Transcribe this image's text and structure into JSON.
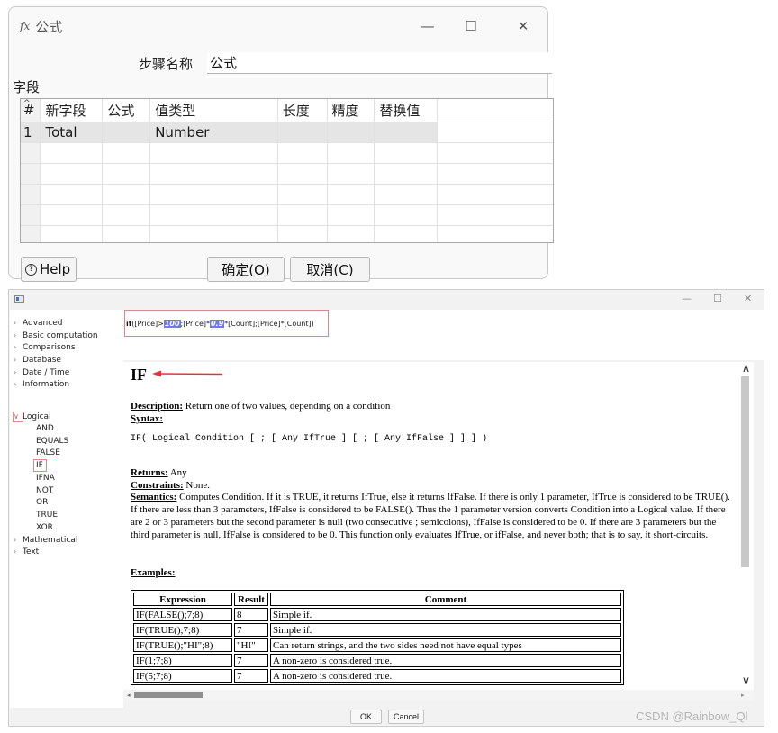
{
  "dialog": {
    "title": "公式",
    "fx_icon": "fx",
    "minimize": "—",
    "maximize": "☐",
    "close": "✕",
    "step_name_label": "步骤名称",
    "step_name_value": "公式",
    "fields_label": "字段",
    "table": {
      "sort_marker": "^",
      "headers": [
        "#",
        "新字段",
        "公式",
        "值类型",
        "长度",
        "精度",
        "替换值"
      ],
      "rows": [
        [
          "1",
          "Total",
          "",
          "Number",
          "",
          "",
          ""
        ]
      ]
    },
    "help_button": "Help",
    "ok_button": "确定(O)",
    "cancel_button": "取消(C)"
  },
  "window": {
    "min": "—",
    "max": "☐",
    "close": "✕",
    "tree": {
      "items": [
        {
          "label": "Advanced",
          "type": "collapsed"
        },
        {
          "label": "Basic computation",
          "type": "collapsed"
        },
        {
          "label": "Comparisons",
          "type": "collapsed"
        },
        {
          "label": "Database",
          "type": "collapsed"
        },
        {
          "label": "Date / Time",
          "type": "collapsed"
        },
        {
          "label": "Information",
          "type": "collapsed"
        },
        {
          "label": "Logical",
          "type": "expanded"
        },
        {
          "label": "AND",
          "type": "child"
        },
        {
          "label": "EQUALS",
          "type": "child"
        },
        {
          "label": "FALSE",
          "type": "child"
        },
        {
          "label": "IF",
          "type": "child-selected"
        },
        {
          "label": "IFNA",
          "type": "child"
        },
        {
          "label": "NOT",
          "type": "child"
        },
        {
          "label": "OR",
          "type": "child"
        },
        {
          "label": "TRUE",
          "type": "child"
        },
        {
          "label": "XOR",
          "type": "child"
        },
        {
          "label": "Mathematical",
          "type": "collapsed"
        },
        {
          "label": "Text",
          "type": "collapsed"
        }
      ]
    },
    "formula": {
      "prefix": "if",
      "part1": "([Price]>",
      "hl1": "100",
      "part2": ";[Price]*",
      "hl2": "0.9",
      "part3": "*[Count];[Price]*[Count])"
    },
    "doc": {
      "title": "IF",
      "description_label": "Description:",
      "description": " Return one of two values, depending on a condition",
      "syntax_label": "Syntax:",
      "syntax": "IF( Logical Condition [ ; [ Any IfTrue ] [ ; [ Any IfFalse ] ] ] )",
      "returns_label": "Returns:",
      "returns": " Any",
      "constraints_label": "Constraints:",
      "constraints": " None.",
      "semantics_label": "Semantics:",
      "semantics": " Computes Condition. If it is TRUE, it returns IfTrue, else it returns IfFalse. If there is only 1 parameter, IfTrue is considered to be TRUE(). If there are less than 3 parameters, IfFalse is considered to be FALSE(). Thus the 1 parameter version converts Condition into a Logical value. If there are 2 or 3 parameters but the second parameter is null (two consecutive ; semicolons), IfFalse is considered to be 0. If there are 3 parameters but the third parameter is null, IfFalse is considered to be 0. This function only evaluates IfTrue, or ifFalse, and never both; that is to say, it short-circuits.",
      "examples_label": "Examples:",
      "examples": {
        "headers": [
          "Expression",
          "Result",
          "Comment"
        ],
        "rows": [
          [
            "IF(FALSE();7;8)",
            "8",
            "Simple if."
          ],
          [
            "IF(TRUE();7;8)",
            "7",
            "Simple if."
          ],
          [
            "IF(TRUE();\"HI\";8)",
            "\"HI\"",
            "Can return strings, and the two sides need not have equal types"
          ],
          [
            "IF(1;7;8)",
            "7",
            "A non-zero is considered true."
          ],
          [
            "IF(5;7;8)",
            "7",
            "A non-zero is considered true."
          ]
        ]
      }
    },
    "ok_button": "OK",
    "cancel_button": "Cancel"
  },
  "watermark": "CSDN @Rainbow_Ql",
  "colors": {
    "highlight": "#6f7be9",
    "annotation_red": "#e0363b",
    "selected_row": "#e5e5e5"
  }
}
